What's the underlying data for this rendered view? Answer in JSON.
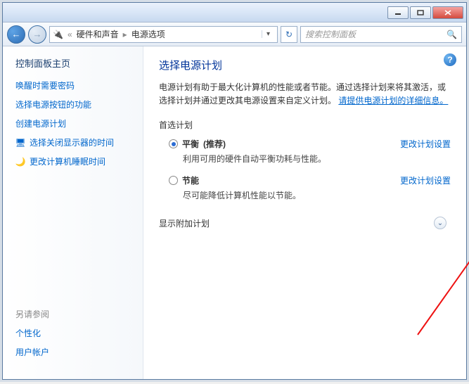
{
  "breadcrumb": {
    "level1": "硬件和声音",
    "level2": "电源选项"
  },
  "search": {
    "placeholder": "搜索控制面板"
  },
  "sidebar": {
    "title": "控制面板主页",
    "links": [
      {
        "label": "唤醒时需要密码"
      },
      {
        "label": "选择电源按钮的功能"
      },
      {
        "label": "创建电源计划"
      },
      {
        "label": "选择关闭显示器的时间"
      },
      {
        "label": "更改计算机睡眠时间"
      }
    ],
    "see_also_title": "另请参阅",
    "see_also": [
      {
        "label": "个性化"
      },
      {
        "label": "用户帐户"
      }
    ]
  },
  "main": {
    "heading": "选择电源计划",
    "desc_part1": "电源计划有助于最大化计算机的性能或者节能。通过选择计划来将其激活，或选择计划并通过更改其电源设置来自定义计划。",
    "desc_link": "请提供电源计划的详细信息。",
    "preferred_title": "首选计划",
    "plans": [
      {
        "name": "平衡",
        "rec": "(推荐)",
        "desc": "利用可用的硬件自动平衡功耗与性能。",
        "change": "更改计划设置",
        "checked": true
      },
      {
        "name": "节能",
        "rec": "",
        "desc": "尽可能降低计算机性能以节能。",
        "change": "更改计划设置",
        "checked": false
      }
    ],
    "extra_title": "显示附加计划"
  }
}
